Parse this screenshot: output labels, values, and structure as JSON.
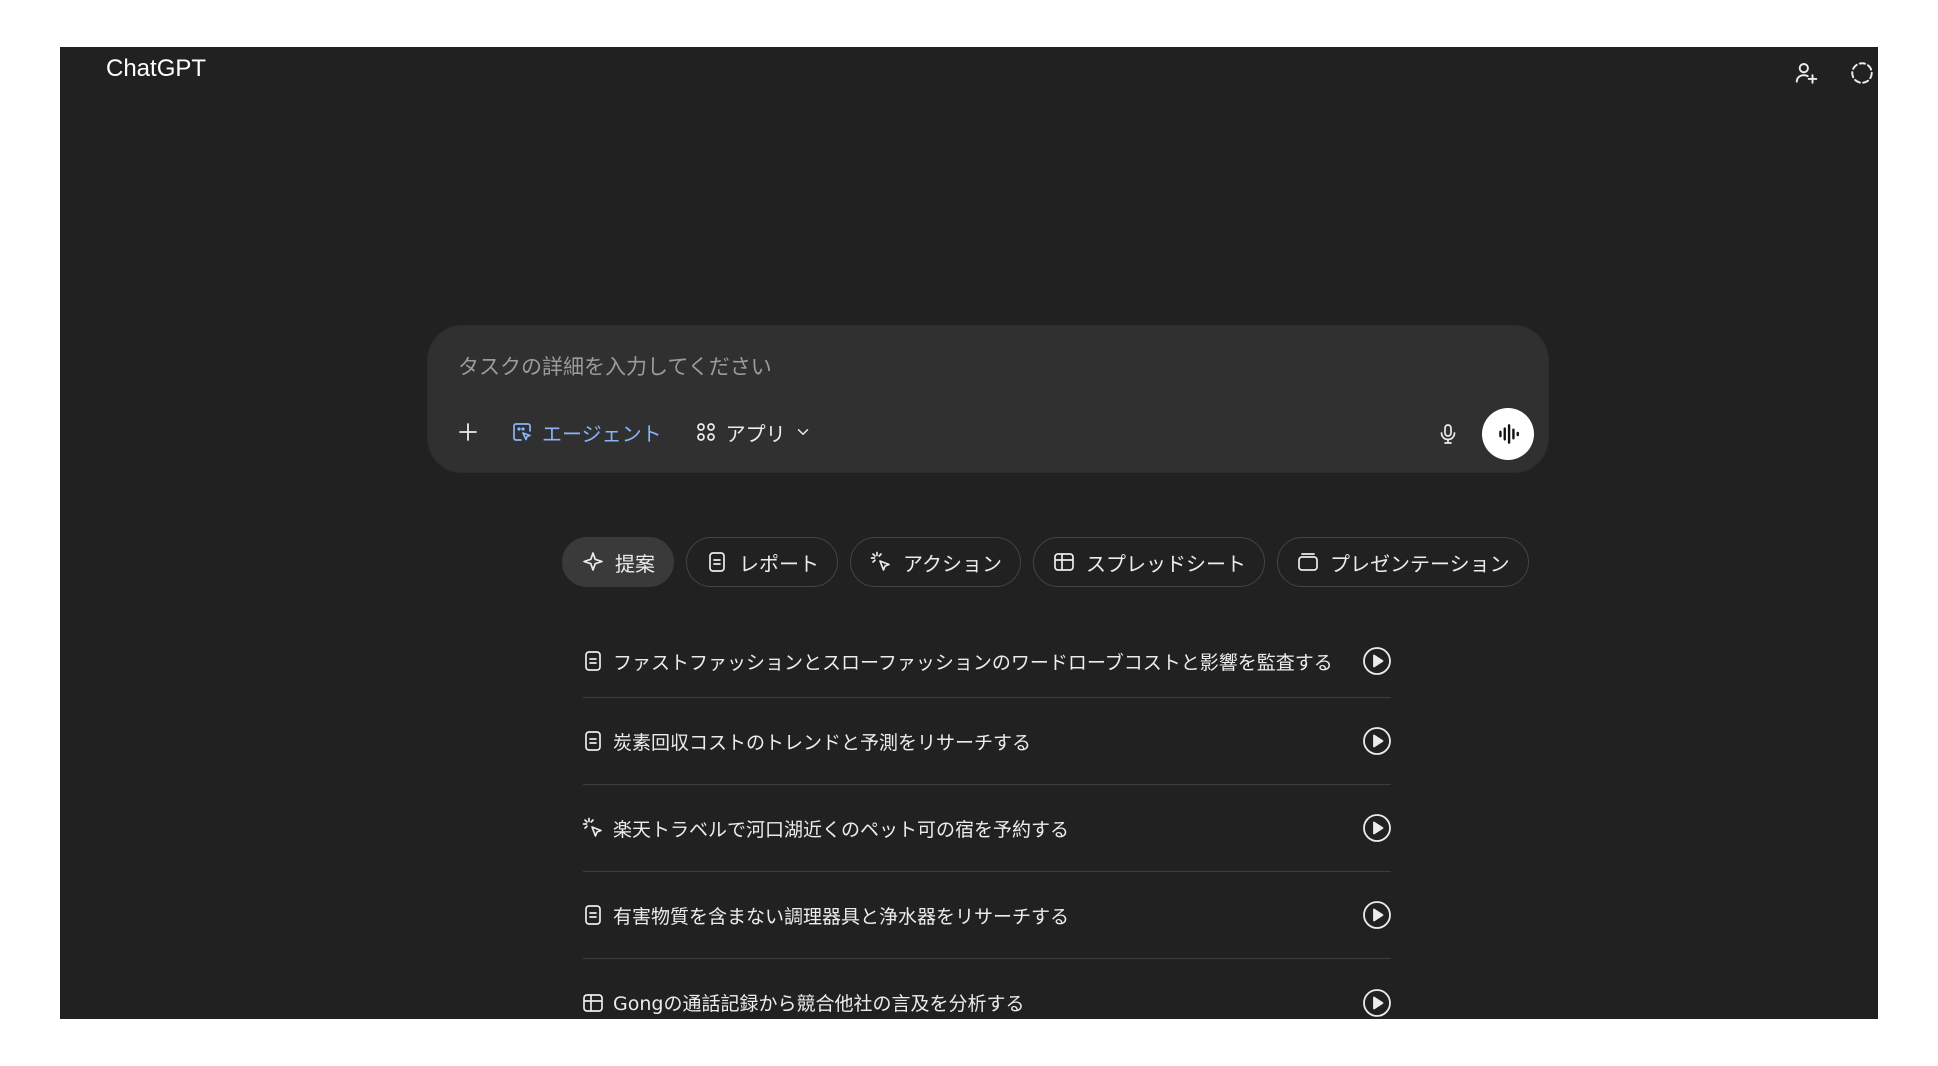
{
  "app": {
    "title": "ChatGPT",
    "top_icons": [
      "add-person-icon",
      "dashed-circle-icon"
    ]
  },
  "composer": {
    "placeholder": "タスクの詳細を入力してください",
    "agent_label": "エージェント",
    "apps_label": "アプリ"
  },
  "chips": [
    {
      "label": "提案",
      "icon": "sparkle-icon",
      "active": true
    },
    {
      "label": "レポート",
      "icon": "document-icon"
    },
    {
      "label": "アクション",
      "icon": "click-icon"
    },
    {
      "label": "スプレッドシート",
      "icon": "table-icon"
    },
    {
      "label": "プレゼンテーション",
      "icon": "slides-icon"
    }
  ],
  "suggestions": [
    {
      "text": "ファストファッションとスローファッションのワードローブコストと影響を監査する",
      "icon": "document-icon"
    },
    {
      "text": "炭素回収コストのトレンドと予測をリサーチする",
      "icon": "document-icon"
    },
    {
      "text": "楽天トラベルで河口湖近くのペット可の宿を予約する",
      "icon": "click-icon"
    },
    {
      "text": "有害物質を含まない調理器具と浄水器をリサーチする",
      "icon": "document-icon"
    },
    {
      "text": "Gongの通話記録から競合他社の言及を分析する",
      "icon": "table-icon"
    }
  ],
  "colors": {
    "background": "#212121",
    "composer": "#303030",
    "agent_accent": "#8ab4f8"
  }
}
